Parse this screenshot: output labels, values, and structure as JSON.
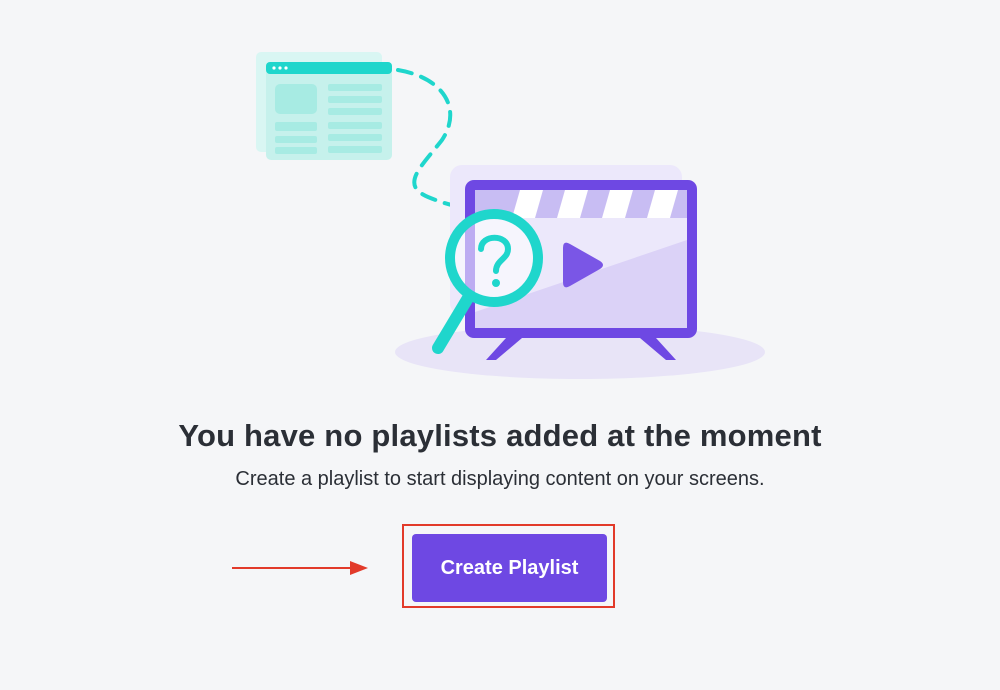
{
  "empty_state": {
    "title": "You have no playlists added at the moment",
    "subtitle": "Create a playlist to start displaying content on your screens.",
    "create_button_label": "Create Playlist"
  },
  "colors": {
    "background": "#f5f6f8",
    "button": "#6e48e3",
    "highlight": "#e23a2a",
    "accent_teal": "#1fd6cc",
    "accent_purple": "#6e48e3"
  },
  "icons": {
    "illustration": "empty-playlist-illustration",
    "magnifier": "question-magnifier-icon",
    "play": "play-icon",
    "arrow": "arrow-right-icon"
  }
}
